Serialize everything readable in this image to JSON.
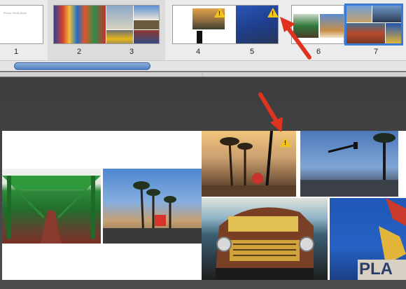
{
  "pages": [
    {
      "number": "1"
    },
    {
      "number": "2"
    },
    {
      "number": "3"
    },
    {
      "number": "4"
    },
    {
      "number": "5"
    },
    {
      "number": "6"
    },
    {
      "number": "7"
    }
  ],
  "cover_text": "iPhoto Photo Book",
  "sign_text": "PLA",
  "warning_glyph": "!",
  "colors": {
    "accent": "#3a7bd5",
    "warning": "#f3c51b",
    "arrow": "#e0331f"
  }
}
